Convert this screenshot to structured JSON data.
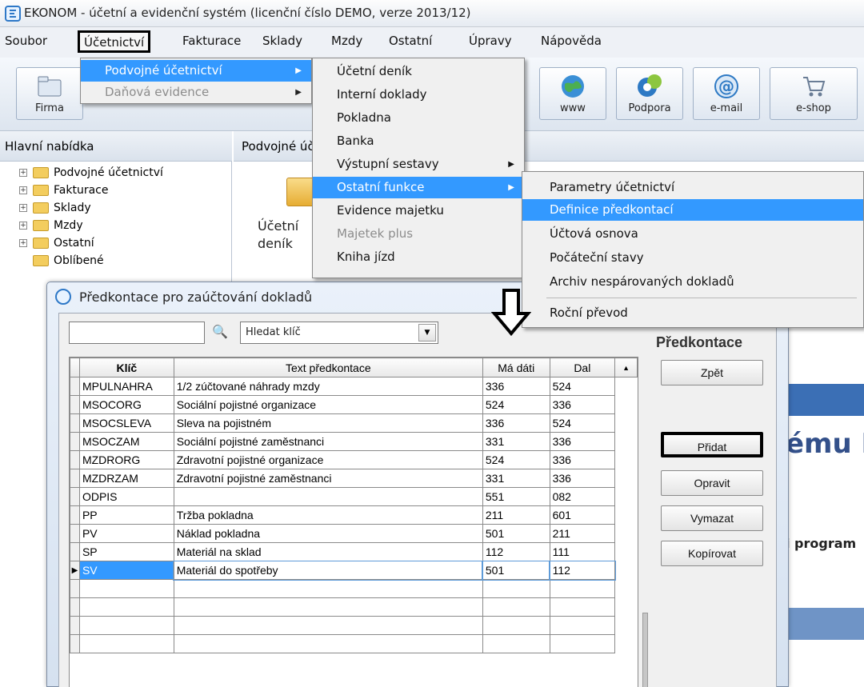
{
  "window": {
    "title": "EKONOM - účetní a evidenční systém (licenční číslo DEMO, verze 2013/12)"
  },
  "menubar": {
    "items": [
      "Soubor",
      "Účetnictví",
      "Fakturace",
      "Sklady",
      "Mzdy",
      "Ostatní",
      "Úpravy",
      "Nápověda"
    ]
  },
  "toolbar": {
    "buttons": [
      "Firma",
      "www",
      "Podpora",
      "e-mail",
      "e-shop"
    ]
  },
  "menu_ucetnictvi": {
    "items": [
      "Podvojné účetnictví",
      "Daňová evidence"
    ]
  },
  "menu_podvojne": {
    "items": [
      "Účetní deník",
      "Interní doklady",
      "Pokladna",
      "Banka",
      "Výstupní sestavy",
      "Ostatní funkce",
      "Evidence majetku",
      "Majetek plus",
      "Kniha jízd"
    ]
  },
  "menu_ostatni": {
    "items": [
      "Parametry účetnictví",
      "Definice předkontací",
      "Účtová osnova",
      "Počáteční stavy",
      "Archiv nespárovaných dokladů",
      "Roční převod"
    ]
  },
  "left_panel": {
    "header": "Hlavní nabídka",
    "tree": [
      "Podvojné účetnictví",
      "Fakturace",
      "Sklady",
      "Mzdy",
      "Ostatní",
      "Oblíbené"
    ]
  },
  "center": {
    "header": "Podvojné účetnictví",
    "tile_line1": "Účetní",
    "tile_line2": "deník",
    "right_text1": "ému E",
    "right_text2": "i program"
  },
  "dialog": {
    "title": "Předkontace pro zaúčtování dokladů",
    "search_value": "",
    "search_select": "Hledat klíč",
    "panel_title": "Předkontace",
    "buttons": {
      "zpet": "Zpět",
      "pridat": "Přidat",
      "opravit": "Opravit",
      "vymazat": "Vymazat",
      "kopirovat": "Kopírovat"
    }
  },
  "grid": {
    "headers": [
      "Klíč",
      "Text předkontace",
      "Má dáti",
      "Dal"
    ],
    "rows": [
      [
        "MPULNAHRA",
        "1/2 zúčtované náhrady mzdy",
        "336",
        "524"
      ],
      [
        "MSOCORG",
        "Sociální pojistné organizace",
        "524",
        "336"
      ],
      [
        "MSOCSLEVA",
        "Sleva na pojistném",
        "336",
        "524"
      ],
      [
        "MSOCZAM",
        "Sociální pojistné zaměstnanci",
        "331",
        "336"
      ],
      [
        "MZDRORG",
        "Zdravotní pojistné organizace",
        "524",
        "336"
      ],
      [
        "MZDRZAM",
        "Zdravotní pojistné zaměstnanci",
        "331",
        "336"
      ],
      [
        "ODPIS",
        "",
        "551",
        "082"
      ],
      [
        "PP",
        "Tržba pokladna",
        "211",
        "601"
      ],
      [
        "PV",
        "Náklad pokladna",
        "501",
        "211"
      ],
      [
        "SP",
        "Materiál na sklad",
        "112",
        "111"
      ],
      [
        "SV",
        "Materiál do spotřeby",
        "501",
        "112"
      ]
    ],
    "selected_row": 10
  }
}
